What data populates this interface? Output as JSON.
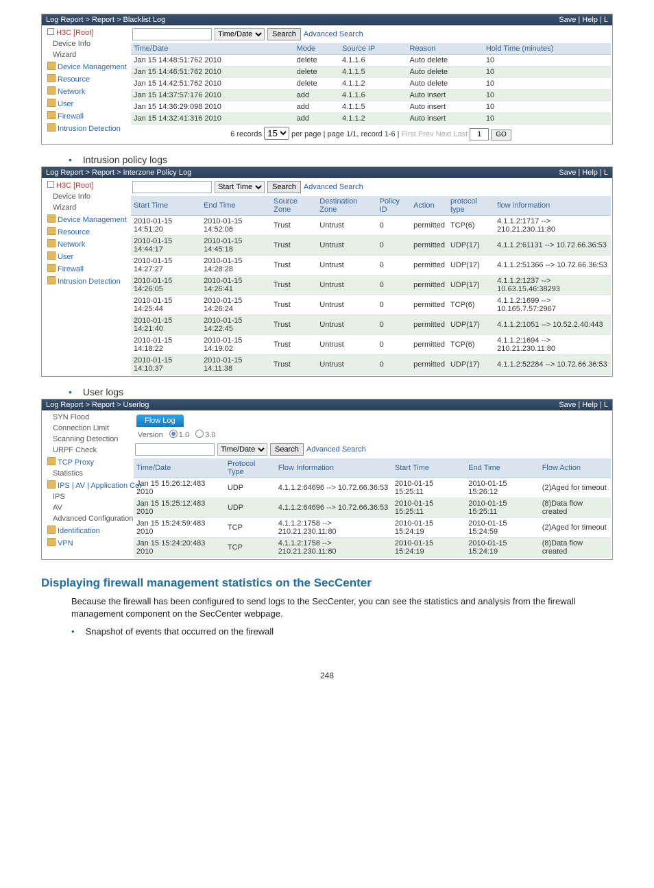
{
  "panel1": {
    "crumb": "Log Report > Report > Blacklist Log",
    "crumb_right": "Save | Help | L",
    "tree": [
      "H3C [Root]",
      "Device Info",
      "Wizard",
      "Device Management",
      "Resource",
      "Network",
      "User",
      "Firewall",
      "Intrusion Detection"
    ],
    "search_field": "Time/Date",
    "search_btn": "Search",
    "adv": "Advanced Search",
    "cols": [
      "Time/Date",
      "Mode",
      "Source IP",
      "Reason",
      "Hold Time (minutes)"
    ],
    "rows": [
      [
        "Jan 15 14:48:51:762 2010",
        "delete",
        "4.1.1.6",
        "Auto delete",
        "10"
      ],
      [
        "Jan 15 14:46:51:762 2010",
        "delete",
        "4.1.1.5",
        "Auto delete",
        "10"
      ],
      [
        "Jan 15 14:42:51:762 2010",
        "delete",
        "4.1.1.2",
        "Auto delete",
        "10"
      ],
      [
        "Jan 15 14:37:57:176 2010",
        "add",
        "4.1.1.6",
        "Auto insert",
        "10"
      ],
      [
        "Jan 15 14:36:29:098 2010",
        "add",
        "4.1.1.5",
        "Auto insert",
        "10"
      ],
      [
        "Jan 15 14:32:41:316 2010",
        "add",
        "4.1.1.2",
        "Auto insert",
        "10"
      ]
    ],
    "pager_a": "6 records",
    "pager_perpage": "15",
    "pager_b": "per page | page 1/1, record 1-6 |",
    "pager_nav": "First  Prev  Next  Last",
    "pager_cur": "1",
    "pager_go": "GO"
  },
  "heading2": "Intrusion policy logs",
  "panel2": {
    "crumb": "Log Report > Report > Interzone Policy Log",
    "crumb_right": "Save | Help | L",
    "tree": [
      "H3C [Root]",
      "Device Info",
      "Wizard",
      "Device Management",
      "Resource",
      "Network",
      "User",
      "Firewall",
      "Intrusion Detection"
    ],
    "search_field": "Start Time",
    "search_btn": "Search",
    "adv": "Advanced Search",
    "cols": [
      "Start Time",
      "End Time",
      "Source Zone",
      "Destination Zone",
      "Policy ID",
      "Action",
      "protocol type",
      "flow information"
    ],
    "rows": [
      [
        "2010-01-15 14:51:20",
        "2010-01-15 14:52:08",
        "Trust",
        "Untrust",
        "0",
        "permitted",
        "TCP(6)",
        "4.1.1.2:1717 --> 210.21.230.11:80"
      ],
      [
        "2010-01-15 14:44:17",
        "2010-01-15 14:45:18",
        "Trust",
        "Untrust",
        "0",
        "permitted",
        "UDP(17)",
        "4.1.1.2:61131 --> 10.72.66.36:53"
      ],
      [
        "2010-01-15 14:27:27",
        "2010-01-15 14:28:28",
        "Trust",
        "Untrust",
        "0",
        "permitted",
        "UDP(17)",
        "4.1.1.2:51366 --> 10.72.66.36:53"
      ],
      [
        "2010-01-15 14:26:05",
        "2010-01-15 14:26:41",
        "Trust",
        "Untrust",
        "0",
        "permitted",
        "UDP(17)",
        "4.1.1.2:1237 --> 10.63.15.46:38293"
      ],
      [
        "2010-01-15 14:25:44",
        "2010-01-15 14:26:24",
        "Trust",
        "Untrust",
        "0",
        "permitted",
        "TCP(6)",
        "4.1.1.2:1699 --> 10.165.7.57:2967"
      ],
      [
        "2010-01-15 14:21:40",
        "2010-01-15 14:22:45",
        "Trust",
        "Untrust",
        "0",
        "permitted",
        "UDP(17)",
        "4.1.1.2:1051 --> 10.52.2.40:443"
      ],
      [
        "2010-01-15 14:18:22",
        "2010-01-15 14:19:02",
        "Trust",
        "Untrust",
        "0",
        "permitted",
        "TCP(6)",
        "4.1.1.2:1694 --> 210.21.230.11:80"
      ],
      [
        "2010-01-15 14:10:37",
        "2010-01-15 14:11:38",
        "Trust",
        "Untrust",
        "0",
        "permitted",
        "UDP(17)",
        "4.1.1.2:52284 --> 10.72.66.36:53"
      ]
    ]
  },
  "heading3": "User logs",
  "panel3": {
    "crumb": "Log Report > Report > Userlog",
    "crumb_right": "Save | Help | L",
    "tree": [
      "SYN Flood",
      "Connection Limit",
      "Scanning Detection",
      "URPF Check",
      "TCP Proxy",
      "Statistics",
      "IPS | AV | Application Cor",
      "IPS",
      "AV",
      "Advanced Configuration",
      "Identification",
      "VPN"
    ],
    "flow_tab": "Flow Log",
    "version_label": "Version",
    "ver_a": "1.0",
    "ver_b": "3.0",
    "search_field": "Time/Date",
    "search_btn": "Search",
    "adv": "Advanced Search",
    "cols": [
      "Time/Date",
      "Protocol Type",
      "Flow Information",
      "Start Time",
      "End Time",
      "Flow Action"
    ],
    "rows": [
      [
        "Jan 15 15:26:12:483 2010",
        "UDP",
        "4.1.1.2:64696 --> 10.72.66.36:53",
        "2010-01-15 15:25:11",
        "2010-01-15 15:26:12",
        "(2)Aged for timeout"
      ],
      [
        "Jan 15 15:25:12:483 2010",
        "UDP",
        "4.1.1.2:64696 --> 10.72.66.36:53",
        "2010-01-15 15:25:11",
        "2010-01-15 15:25:11",
        "(8)Data flow created"
      ],
      [
        "Jan 15 15:24:59:483 2010",
        "TCP",
        "4.1.1.2:1758 --> 210.21.230.11:80",
        "2010-01-15 15:24:19",
        "2010-01-15 15:24:59",
        "(2)Aged for timeout"
      ],
      [
        "Jan 15 15:24:20:483 2010",
        "TCP",
        "4.1.1.2:1758 --> 210.21.230.11:80",
        "2010-01-15 15:24:19",
        "2010-01-15 15:24:19",
        "(8)Data flow created"
      ]
    ]
  },
  "sec_heading": "Displaying firewall management statistics on the SecCenter",
  "para": "Because the firewall has been configured to send logs to the SecCenter, you can see the statistics and analysis from the firewall management component on the SecCenter webpage.",
  "bullet": "Snapshot of events that occurred on the firewall",
  "pagenum": "248"
}
